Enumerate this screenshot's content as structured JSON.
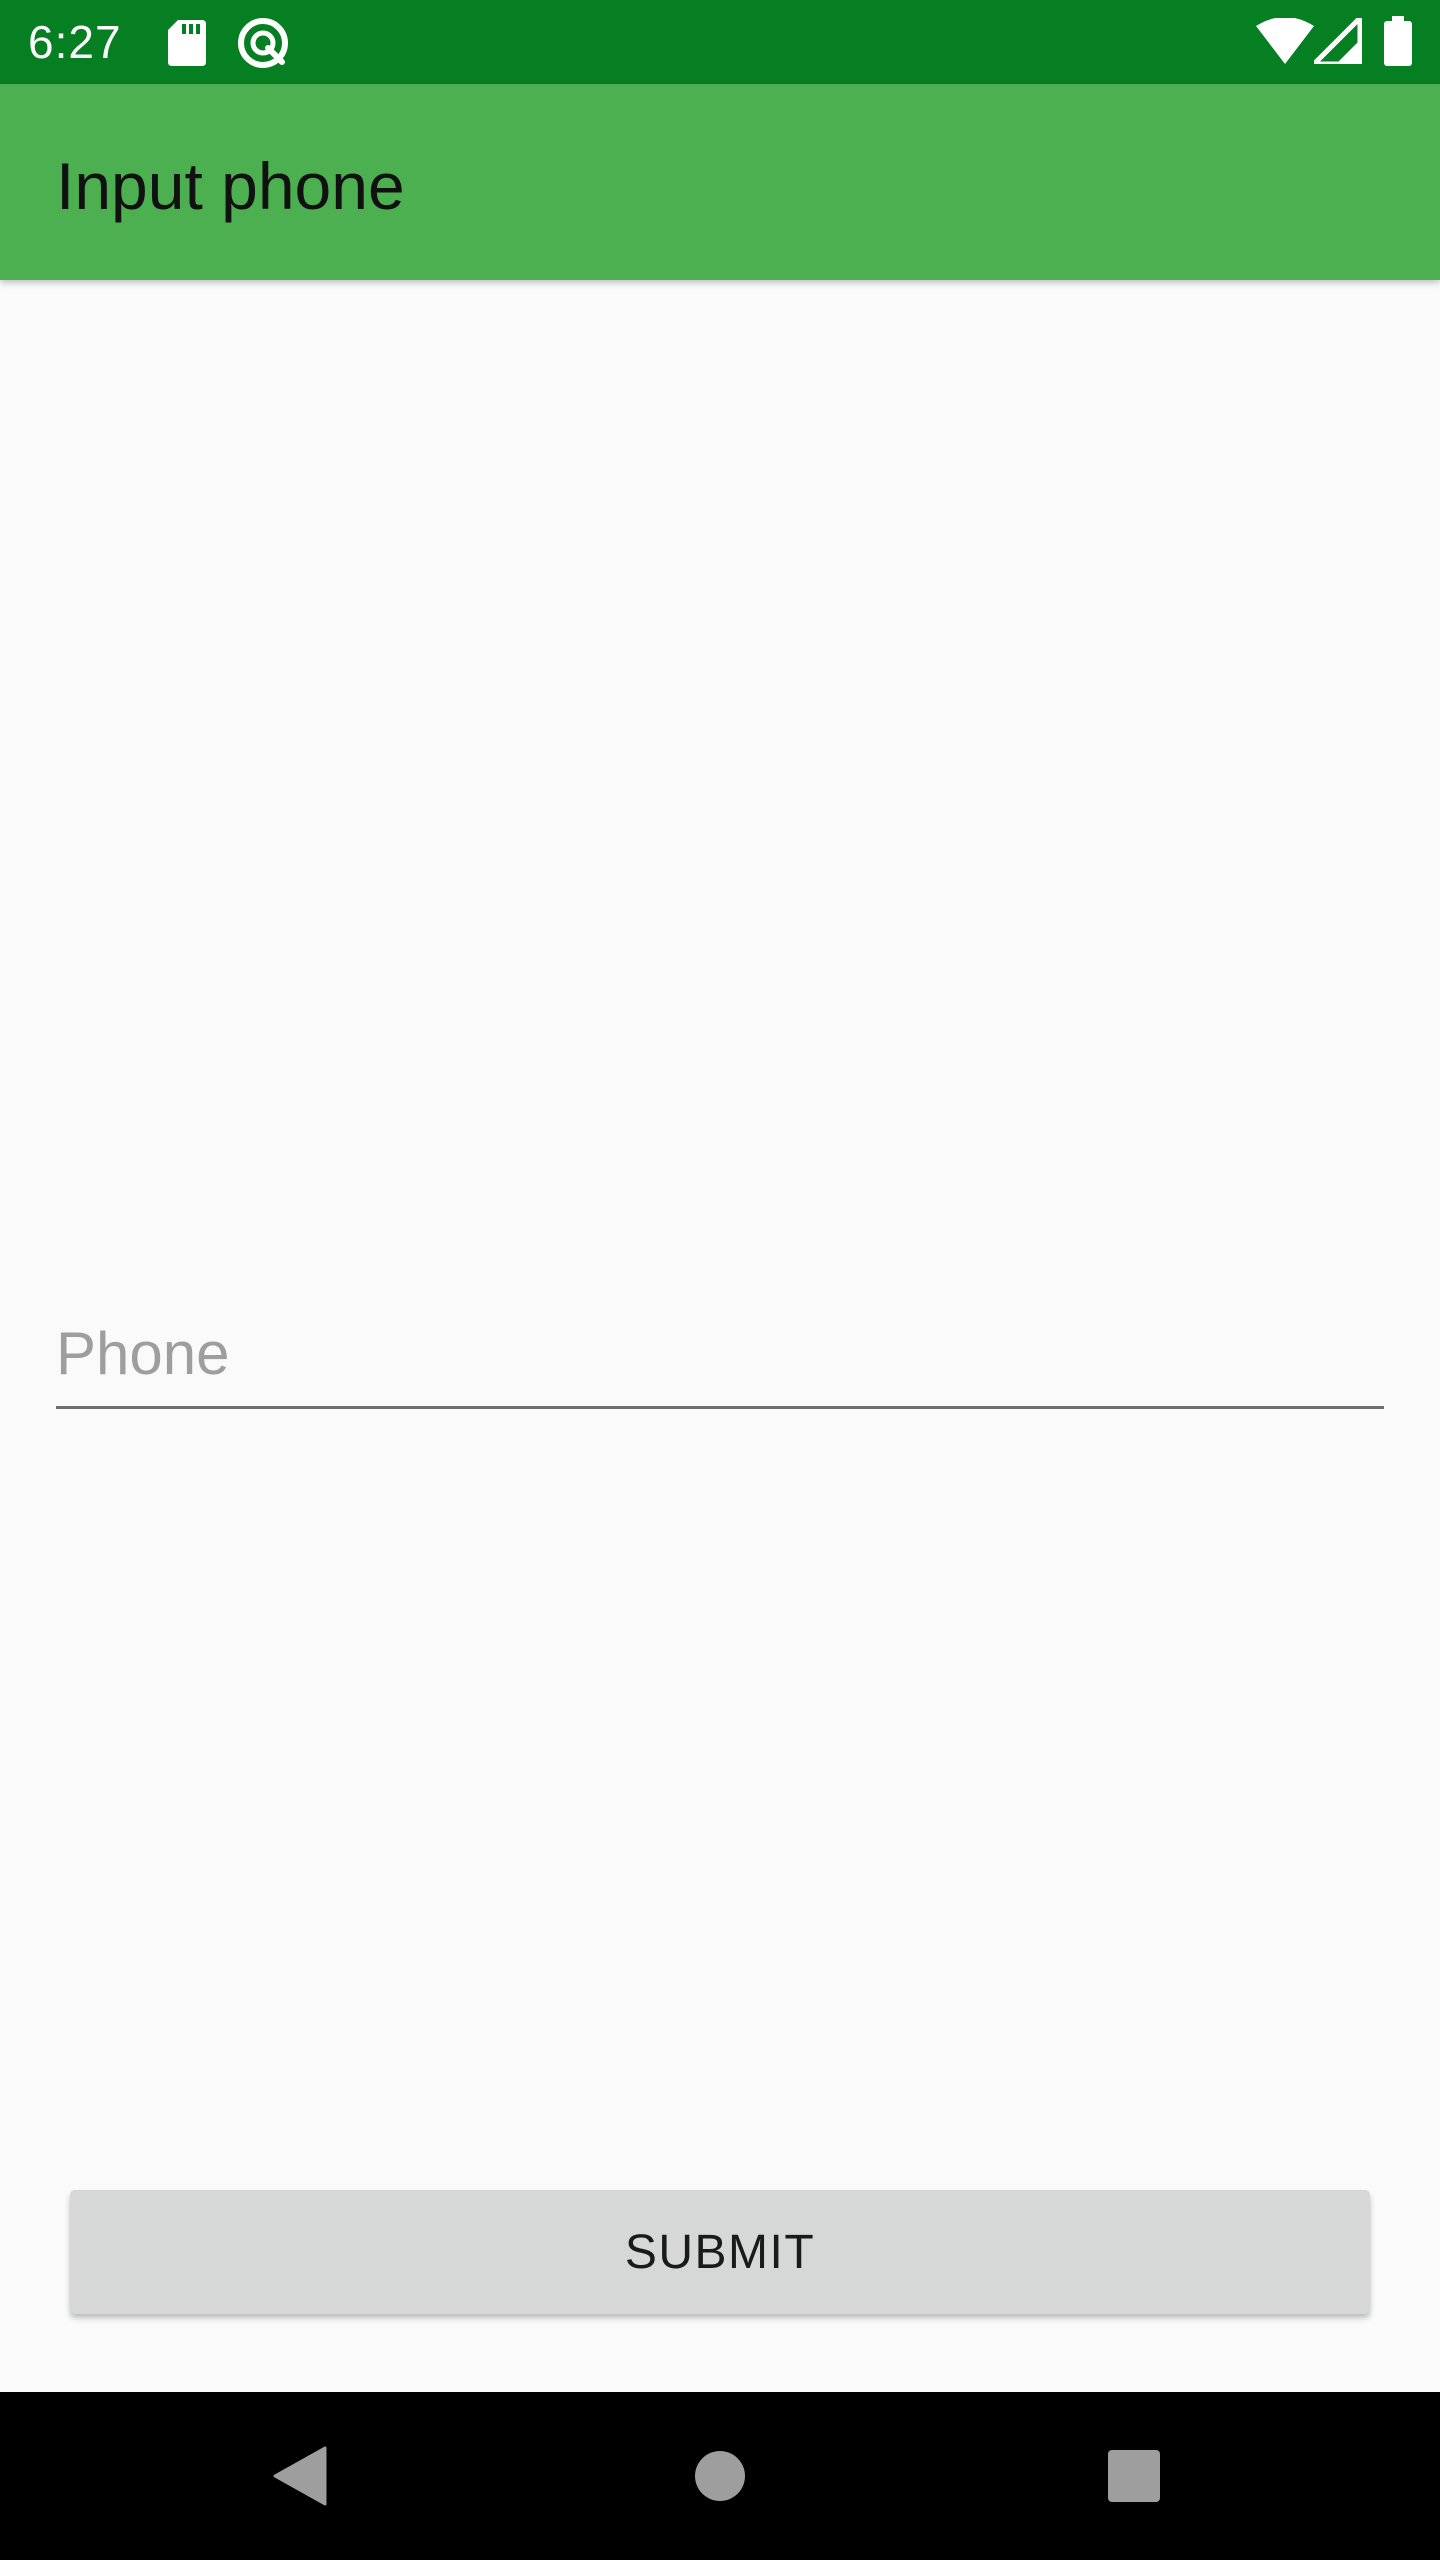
{
  "status_bar": {
    "time": "6:27",
    "icons": [
      "sd-card-icon",
      "sync-icon",
      "wifi-icon",
      "signal-icon",
      "battery-icon"
    ],
    "background_color": "#067e22"
  },
  "app_bar": {
    "title": "Input phone",
    "background_color": "#4caf50"
  },
  "form": {
    "phone": {
      "placeholder": "Phone",
      "value": ""
    },
    "submit_label": "SUBMIT"
  },
  "nav_bar": {
    "buttons": [
      "back-icon",
      "home-icon",
      "recents-icon"
    ]
  }
}
